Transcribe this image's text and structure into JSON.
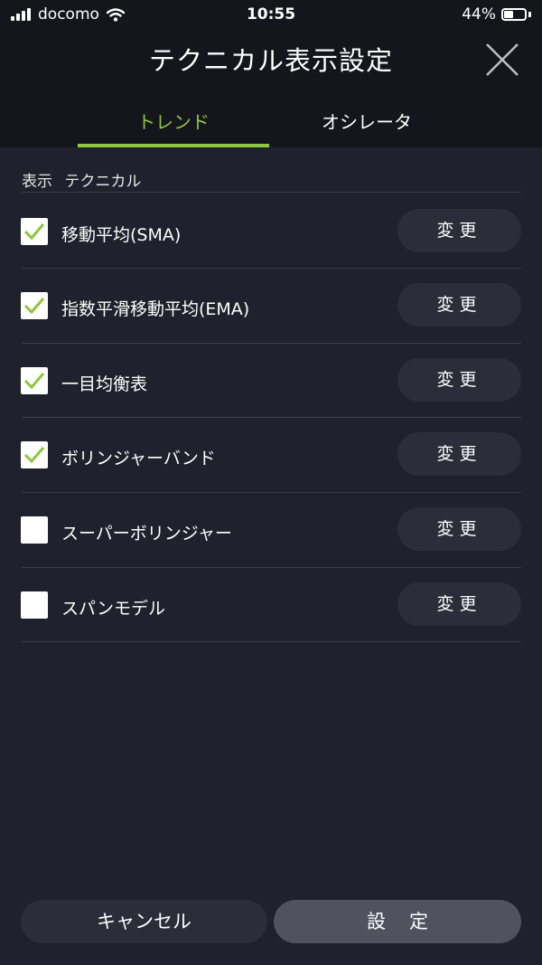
{
  "status": {
    "carrier": "docomo",
    "time": "10:55",
    "battery": "44%",
    "battery_level": 0.44
  },
  "header": {
    "title": "テクニカル表示設定"
  },
  "tabs": [
    {
      "label": "トレンド",
      "active": true
    },
    {
      "label": "オシレータ",
      "active": false
    }
  ],
  "list_header": {
    "col1": "表示",
    "col2": "テクニカル"
  },
  "items": [
    {
      "label": "移動平均(SMA)",
      "checked": true,
      "button": "変更"
    },
    {
      "label": "指数平滑移動平均(EMA)",
      "checked": true,
      "button": "変更"
    },
    {
      "label": "一目均衡表",
      "checked": true,
      "button": "変更"
    },
    {
      "label": "ボリンジャーバンド",
      "checked": true,
      "button": "変更"
    },
    {
      "label": "スーパーボリンジャー",
      "checked": false,
      "button": "変更"
    },
    {
      "label": "スパンモデル",
      "checked": false,
      "button": "変更"
    }
  ],
  "footer": {
    "cancel_label": "キャンセル",
    "set_label": "設定"
  },
  "colors": {
    "accent": "#8ec63f",
    "background": "#1f222c",
    "topbar": "#15161c"
  }
}
